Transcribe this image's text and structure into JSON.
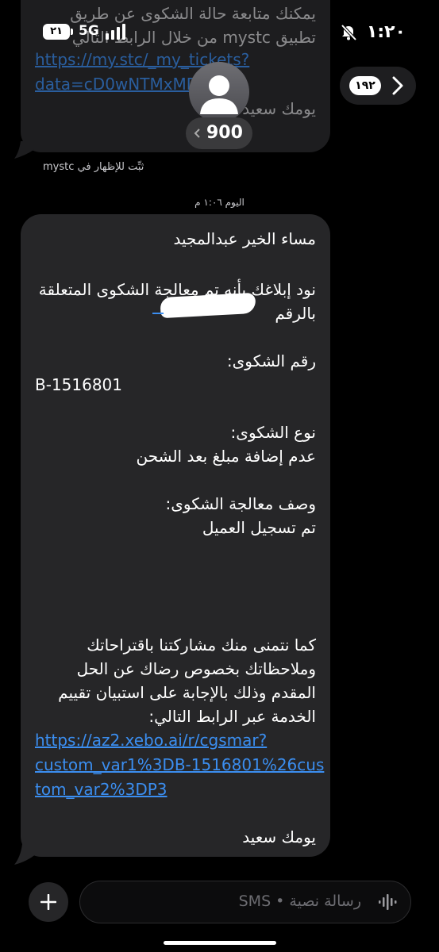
{
  "status": {
    "time": "١:٢٠",
    "network": "5G",
    "battery": "٢١"
  },
  "header": {
    "back_count": "١٩٢",
    "contact_name": "900"
  },
  "prev_message": {
    "lines": [
      "يمكنك متابعة حالة الشكوى عن طريق",
      "تطبيق mystc من خلال الرابط التالي"
    ],
    "link": "https://my.stc/_my_tickets?\ndata=cD0wNTMxMDEwNw",
    "closing": "يومك سعيد"
  },
  "pin_note": "ثبِّت للإظهار في mystc",
  "timestamp": "اليوم ١:٠٦ م",
  "message": {
    "greeting": "مساء الخير عبدالمجيد",
    "notice": "نود إبلاغك بأنه تم معالجة الشكوى المتعلقة\nبالرقم",
    "complaint_no_label": "رقم الشكوى:",
    "complaint_no": "B-1516801",
    "complaint_type_label": "نوع الشكوى:",
    "complaint_type": "عدم إضافة مبلغ بعد الشحن",
    "resolution_label": "وصف معالجة الشكوى:",
    "resolution": "تم تسجيل العميل",
    "survey_text": "كما نتمنى منك مشاركتنا باقتراحاتك\nوملاحظاتك بخصوص رضاك عن الحل\nالمقدم وذلك بالإجابة على استبيان تقييم\nالخدمة عبر الرابط التالي:",
    "survey_link": "https://az2.xebo.ai/r/cgsmar?\ncustom_var1%3DB-1516801%26cus\ntom_var2%3DP3",
    "closing": "يومك سعيد"
  },
  "composer": {
    "placeholder": "رسالة نصية • SMS"
  }
}
